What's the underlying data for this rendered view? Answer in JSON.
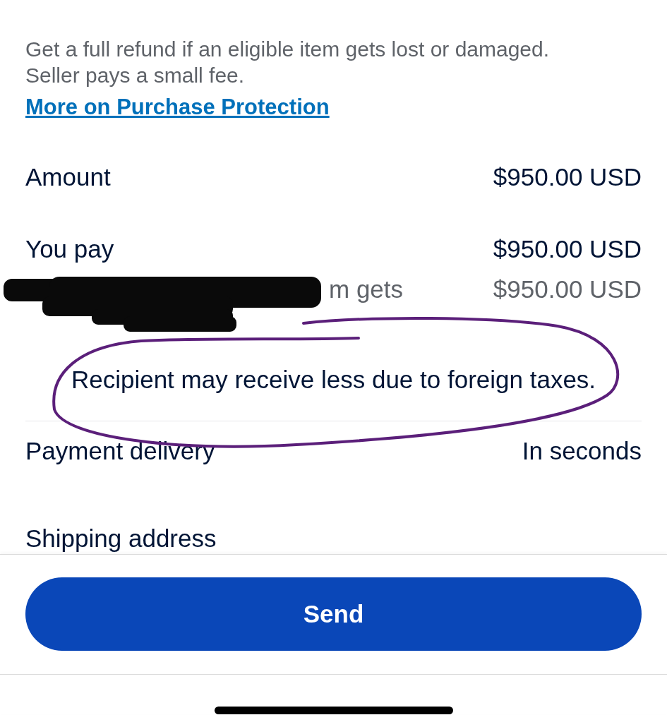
{
  "protection": {
    "description": "Get a full refund if an eligible item gets lost or damaged. Seller pays a small fee.",
    "link": "More on Purchase Protection"
  },
  "summary": [
    {
      "label": "Amount",
      "value": "$950.00 USD",
      "kind": "primary"
    },
    {
      "label": "You pay",
      "value": "$950.00 USD",
      "kind": "primary"
    },
    {
      "label": "m gets",
      "value": "$950.00 USD",
      "kind": "secondary"
    }
  ],
  "note": "Recipient may receive less due to foreign taxes.",
  "delivery": {
    "label": "Payment delivery",
    "value": "In seconds"
  },
  "shipping": {
    "label": "Shipping address"
  },
  "send_button": "Send"
}
